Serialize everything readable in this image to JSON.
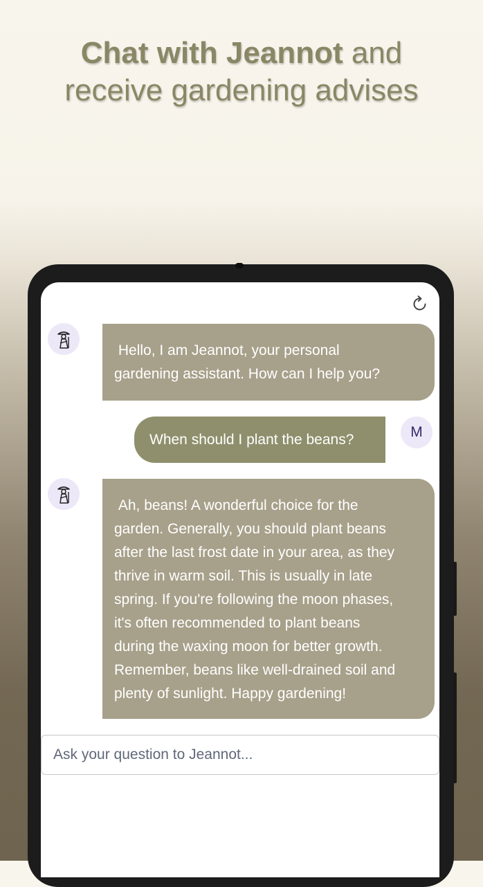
{
  "promo": {
    "title_bold": "Chat with Jeannot",
    "title_rest": " and",
    "subtitle": "receive gardening advises"
  },
  "chat": {
    "messages": [
      {
        "role": "bot",
        "text": " Hello, I am Jeannot, your personal\ngardening assistant. How can I help you?"
      },
      {
        "role": "user",
        "avatar_letter": "M",
        "text": "When should I plant the beans?"
      },
      {
        "role": "bot",
        "text": " Ah, beans! A wonderful choice for the\ngarden. Generally, you should plant beans\nafter the last frost date in your area, as they\nthrive in warm soil. This is usually in late\nspring. If you're following the moon phases,\nit's often recommended to plant beans\nduring the waxing moon for better growth.\nRemember, beans like well-drained soil and\nplenty of sunlight. Happy gardening!"
      }
    ],
    "input": {
      "placeholder": "Ask your question to Jeannot..."
    },
    "icons": {
      "bot_avatar": "gardener-icon",
      "reset": "refresh-icon"
    }
  },
  "colors": {
    "bot_bubble": "#a7a08a",
    "user_bubble": "#8f8f6d",
    "title": "#8a8766",
    "avatar_bg": "#ece8f7"
  }
}
